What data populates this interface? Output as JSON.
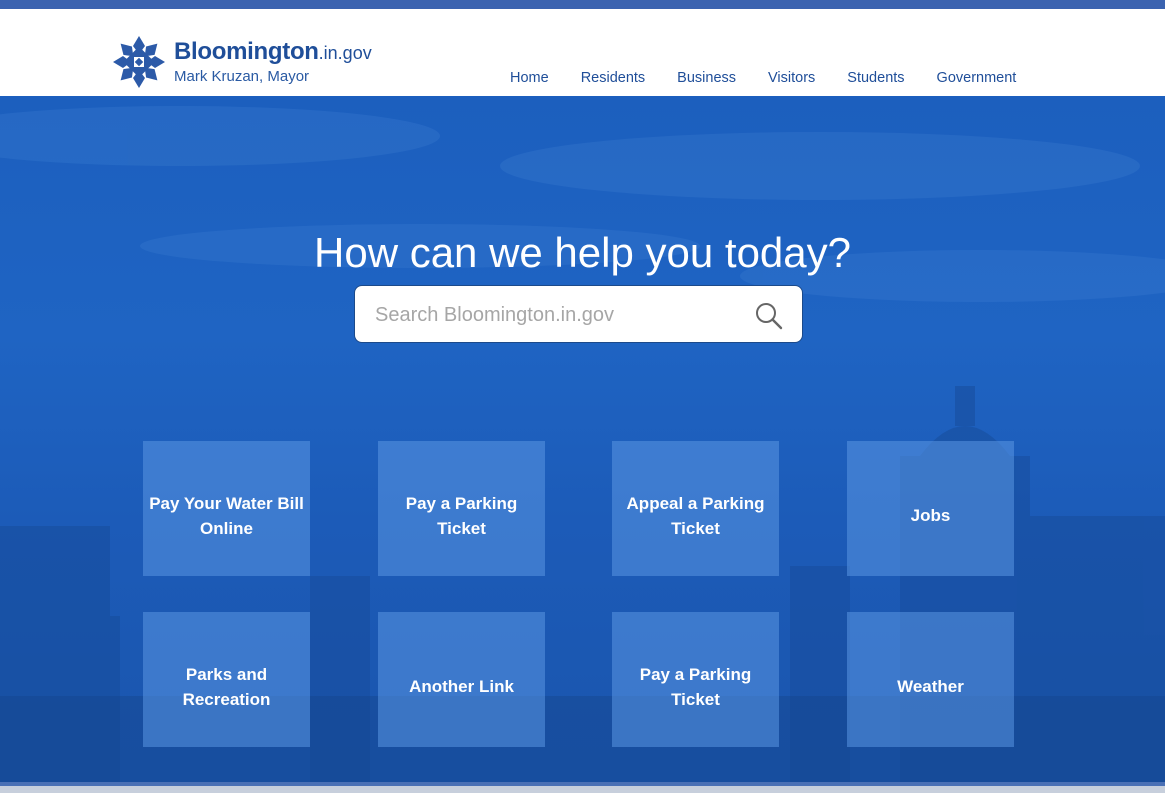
{
  "site": {
    "name": "Bloomington",
    "domain_suffix": ".in.gov",
    "mayor_line": "Mark Kruzan, Mayor",
    "colors": {
      "brand_blue": "#1f4e99",
      "accent_bar": "#3b63b0",
      "hero_blue": "#1f64c3"
    }
  },
  "nav": {
    "items": [
      {
        "label": "Home",
        "active": true
      },
      {
        "label": "Residents",
        "active": false
      },
      {
        "label": "Business",
        "active": false
      },
      {
        "label": "Visitors",
        "active": false
      },
      {
        "label": "Students",
        "active": false
      },
      {
        "label": "Government",
        "active": false
      }
    ]
  },
  "hero": {
    "headline": "How can we help you today?",
    "search": {
      "placeholder": "Search Bloomington.in.gov",
      "value": "",
      "icon": "search-icon"
    }
  },
  "quick_links": [
    {
      "label": "Pay Your Water Bill Online"
    },
    {
      "label": "Pay a Parking Ticket"
    },
    {
      "label": "Appeal a Parking Ticket"
    },
    {
      "label": "Jobs"
    },
    {
      "label": "Parks and Recreation"
    },
    {
      "label": "Another Link"
    },
    {
      "label": "Pay a Parking Ticket"
    },
    {
      "label": "Weather"
    }
  ]
}
